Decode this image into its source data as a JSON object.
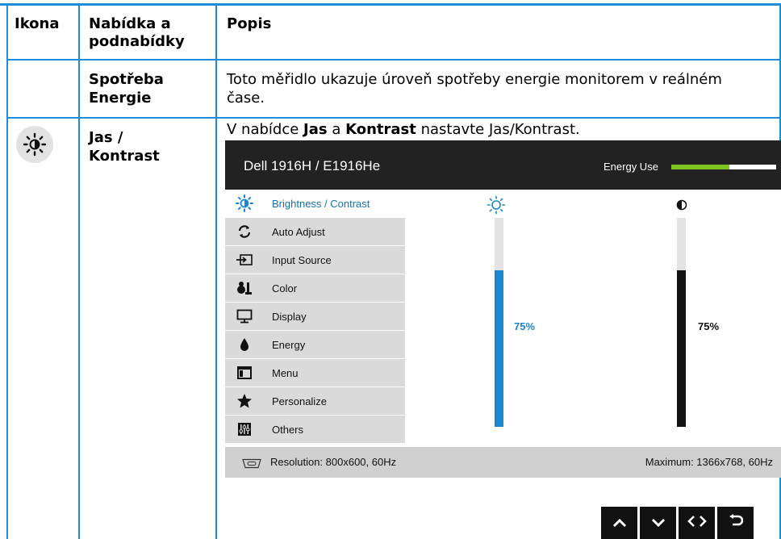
{
  "table": {
    "headers": {
      "icon": "Ikona",
      "menu": "Nabídka a podnabídky",
      "desc": "Popis"
    },
    "rows": [
      {
        "menu": "Spotřeba Energie",
        "desc": "Toto měřidlo ukazuje úroveň spotřeby energie monitorem v reálném čase."
      },
      {
        "icon": "brightness-icon",
        "menu": "Jas / Kontrast",
        "desc_prefix": "V nabídce ",
        "desc_bold1": "Jas",
        "desc_mid": " a ",
        "desc_bold2": "Kontrast",
        "desc_suffix": " nastavte Jas/Kontrast."
      }
    ]
  },
  "osd": {
    "title": "Dell 1916H / E1916He",
    "energy_label": "Energy Use",
    "energy_level": 0.55,
    "menu": [
      {
        "label": "Brightness / Contrast",
        "icon": "brightness-icon",
        "active": true
      },
      {
        "label": "Auto Adjust",
        "icon": "auto-adjust-icon"
      },
      {
        "label": "Input Source",
        "icon": "input-source-icon"
      },
      {
        "label": "Color",
        "icon": "color-icon"
      },
      {
        "label": "Display",
        "icon": "display-icon"
      },
      {
        "label": "Energy",
        "icon": "energy-icon"
      },
      {
        "label": "Menu",
        "icon": "menu-icon"
      },
      {
        "label": "Personalize",
        "icon": "star-icon"
      },
      {
        "label": "Others",
        "icon": "others-icon"
      }
    ],
    "brightness": {
      "value": "75%",
      "level": 0.75,
      "color": "#1a86d0"
    },
    "contrast": {
      "value": "75%",
      "level": 0.75,
      "color": "#111111"
    },
    "footer": {
      "resolution": "Resolution: 800x600, 60Hz",
      "maximum": "Maximum: 1366x768, 60Hz"
    }
  },
  "nav_buttons": [
    "up-arrow-icon",
    "down-arrow-icon",
    "left-right-icon",
    "back-icon"
  ],
  "colors": {
    "grid": "#1f8dd6",
    "osd_header": "#222222",
    "energy_green": "#7dc423"
  }
}
